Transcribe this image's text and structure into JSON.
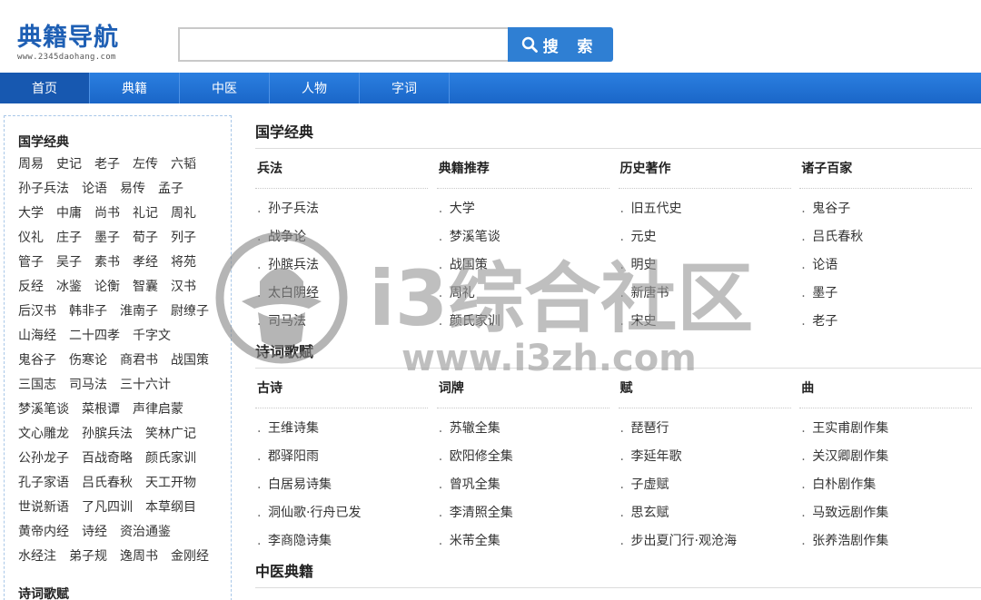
{
  "header": {
    "logo_text": "典籍导航",
    "logo_url": "www.2345daohang.com",
    "search": {
      "value": "",
      "placeholder": "",
      "button_label": "搜 索"
    }
  },
  "nav": {
    "items": [
      {
        "label": "首页",
        "active": true
      },
      {
        "label": "典籍"
      },
      {
        "label": "中医"
      },
      {
        "label": "人物"
      },
      {
        "label": "字词"
      }
    ]
  },
  "sidebar": {
    "title": "国学经典",
    "links": [
      "周易",
      "史记",
      "老子",
      "左传",
      "六韬",
      "孙子兵法",
      "论语",
      "易传",
      "孟子",
      "大学",
      "中庸",
      "尚书",
      "礼记",
      "周礼",
      "仪礼",
      "庄子",
      "墨子",
      "荀子",
      "列子",
      "管子",
      "吴子",
      "素书",
      "孝经",
      "将苑",
      "反经",
      "冰鉴",
      "论衡",
      "智囊",
      "汉书",
      "后汉书",
      "韩非子",
      "淮南子",
      "尉缭子",
      "山海经",
      "二十四孝",
      "千字文",
      "鬼谷子",
      "伤寒论",
      "商君书",
      "战国策",
      "三国志",
      "司马法",
      "三十六计",
      "梦溪笔谈",
      "菜根谭",
      "声律启蒙",
      "文心雕龙",
      "孙膑兵法",
      "笑林广记",
      "公孙龙子",
      "百战奇略",
      "颜氏家训",
      "孔子家语",
      "吕氏春秋",
      "天工开物",
      "世说新语",
      "了凡四训",
      "本草纲目",
      "黄帝内经",
      "诗经",
      "资治通鉴",
      "水经注",
      "弟子规",
      "逸周书",
      "金刚经"
    ],
    "second_title": "诗词歌赋"
  },
  "main": {
    "sections": [
      {
        "title": "国学经典",
        "columns": [
          {
            "title": "兵法",
            "links": [
              "孙子兵法",
              "战争论",
              "孙膑兵法",
              "太白阴经",
              "司马法"
            ]
          },
          {
            "title": "典籍推荐",
            "links": [
              "大学",
              "梦溪笔谈",
              "战国策",
              "周礼",
              "颜氏家训"
            ]
          },
          {
            "title": "历史著作",
            "links": [
              "旧五代史",
              "元史",
              "明史",
              "新唐书",
              "宋史"
            ]
          },
          {
            "title": "诸子百家",
            "links": [
              "鬼谷子",
              "吕氏春秋",
              "论语",
              "墨子",
              "老子"
            ]
          }
        ]
      },
      {
        "title": "诗词歌赋",
        "columns": [
          {
            "title": "古诗",
            "links": [
              "王维诗集",
              "郡驿阳雨",
              "白居易诗集",
              "洞仙歌·行舟已发",
              "李商隐诗集"
            ]
          },
          {
            "title": "词牌",
            "links": [
              "苏辙全集",
              "欧阳修全集",
              "曾巩全集",
              "李清照全集",
              "米芾全集"
            ]
          },
          {
            "title": "赋",
            "links": [
              "琵琶行",
              "李延年歌",
              "子虚赋",
              "思玄赋",
              "步出夏门行·观沧海"
            ]
          },
          {
            "title": "曲",
            "links": [
              "王实甫剧作集",
              "关汉卿剧作集",
              "白朴剧作集",
              "马致远剧作集",
              "张养浩剧作集"
            ]
          }
        ]
      },
      {
        "title": "中医典籍",
        "columns": []
      }
    ]
  },
  "watermark": {
    "text_cn": "i3综合社区",
    "text_url": "www.i3zh.com"
  },
  "colors": {
    "nav_blue": "#1f6fd6",
    "search_button": "#2f7fd3",
    "logo_blue": "#1e5fb4"
  }
}
